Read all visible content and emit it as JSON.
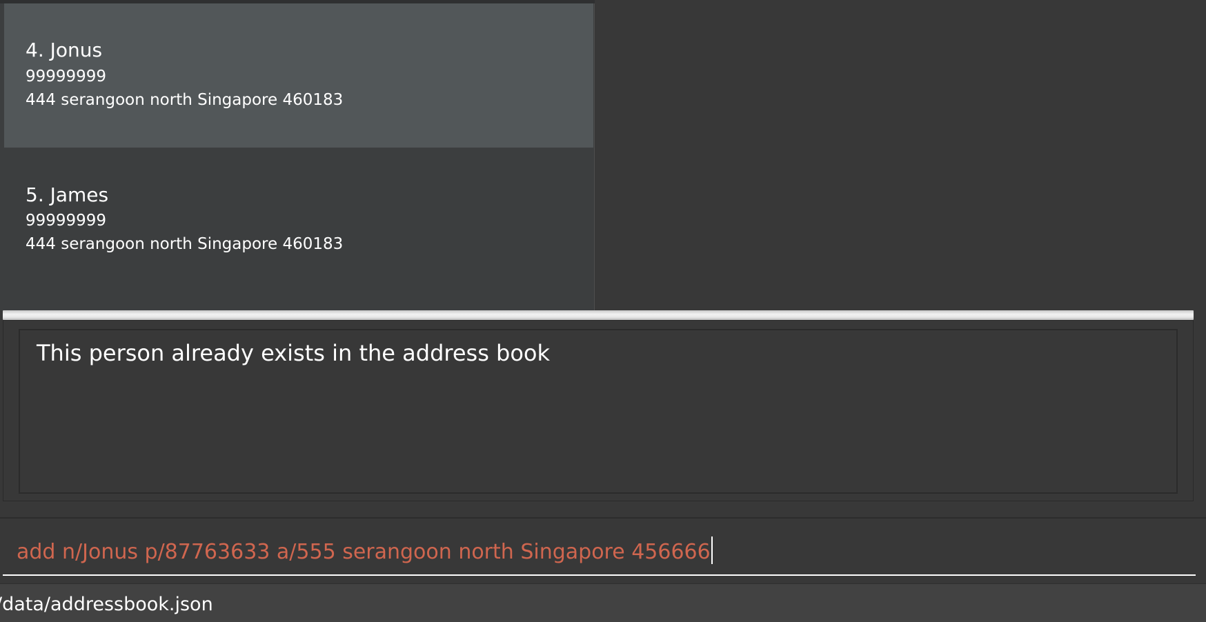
{
  "person_list": [
    {
      "index_name": "4. Jonus",
      "phone": "99999999",
      "address": "444 serangoon north Singapore 460183",
      "selected": true
    },
    {
      "index_name": "5. James",
      "phone": "99999999",
      "address": "444 serangoon north Singapore 460183",
      "selected": false
    }
  ],
  "result_display": {
    "message": "This person already exists in the address book"
  },
  "command_box": {
    "value": "add n/Jonus p/87763633 a/555 serangoon north Singapore 456666",
    "error_color": "#d0664f"
  },
  "status_bar": {
    "save_location": "/data/addressbook.json"
  },
  "colors": {
    "background": "#383838",
    "selected_card": "#525759",
    "card": "#3c3e3f"
  }
}
